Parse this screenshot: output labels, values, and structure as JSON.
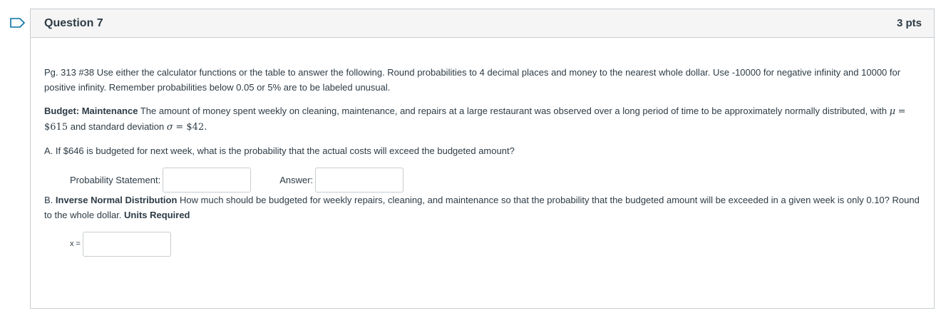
{
  "question": {
    "title": "Question 7",
    "points": "3 pts",
    "intro": "Pg. 313 #38 Use either the calculator functions or the table to answer the following. Round probabilities to 4 decimal places and money to the nearest whole dollar. Use -10000 for negative infinity and 10000 for positive infinity. Remember probabilities below 0.05 or 5% are to be labeled unusual.",
    "budget_heading": "Budget: Maintenance",
    "budget_text": "The amount of money spent weekly on cleaning, maintenance, and repairs at a large restaurant was observed over a long period of time to be approximately normally distributed, with",
    "mu_symbol": "μ",
    "mu_value": "= $615",
    "sd_text": "and standard deviation",
    "sigma_symbol": "σ",
    "sigma_value": "= $42",
    "part_a": "A. If $646 is budgeted for next week, what is the probability that the actual costs will exceed the budgeted amount?",
    "prob_statement_label": "Probability Statement:",
    "prob_statement_value": "",
    "answer_label": "Answer:",
    "answer_value": "",
    "part_b_prefix": "B.",
    "part_b_heading": "Inverse Normal Distribution",
    "part_b_text": "How much should be budgeted for weekly repairs, cleaning, and maintenance so that the probability that the budgeted amount will be exceeded in a given week is only 0.10? Round to the whole dollar.",
    "units_required": "Units Required",
    "x_label": "x =",
    "x_value": ""
  },
  "colors": {
    "flag_stroke": "#0770a3",
    "border": "#c7cdd1",
    "header_bg": "#f5f5f5",
    "text": "#2d3b45"
  },
  "icons": {
    "flag": "bookmark-flag-icon"
  }
}
